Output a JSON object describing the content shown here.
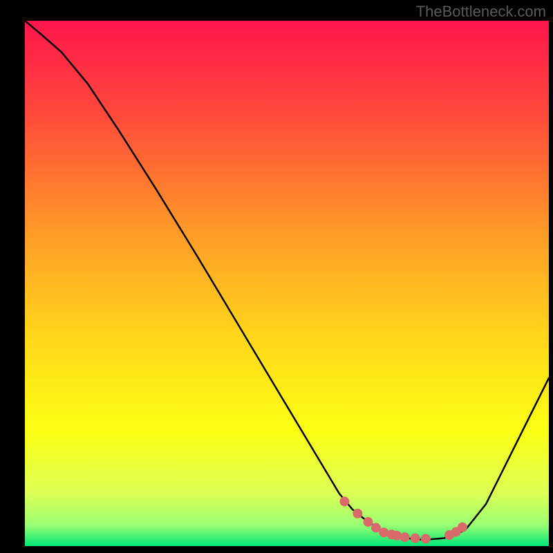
{
  "watermark": "TheBottleneck.com",
  "chart_data": {
    "type": "line",
    "title": "",
    "xlabel": "",
    "ylabel": "",
    "xlim": [
      0,
      100
    ],
    "ylim": [
      0,
      100
    ],
    "gradient_stops": [
      {
        "offset": 0.0,
        "color": "#ff164c"
      },
      {
        "offset": 0.18,
        "color": "#ff4a3a"
      },
      {
        "offset": 0.4,
        "color": "#ff9a28"
      },
      {
        "offset": 0.6,
        "color": "#ffd61a"
      },
      {
        "offset": 0.78,
        "color": "#fbff13"
      },
      {
        "offset": 0.9,
        "color": "#dcff55"
      },
      {
        "offset": 0.96,
        "color": "#9bff73"
      },
      {
        "offset": 1.0,
        "color": "#00e676"
      }
    ],
    "series": [
      {
        "name": "curve",
        "type": "line",
        "color": "#000000",
        "x": [
          0,
          3,
          7,
          12,
          18,
          25,
          33,
          42,
          51,
          57,
          60,
          62.5,
          65,
          68,
          72,
          76,
          80,
          84,
          88,
          92,
          96,
          100
        ],
        "y": [
          100,
          97.5,
          94,
          88,
          79,
          68,
          55,
          40,
          25,
          15,
          10,
          7,
          5,
          3,
          1.6,
          1.2,
          1.5,
          3,
          8,
          16,
          24,
          32
        ]
      },
      {
        "name": "dots",
        "type": "scatter",
        "color": "#d96a6a",
        "radius": 7,
        "x": [
          61,
          63.5,
          65.5,
          67,
          68.5,
          70,
          71,
          72.5,
          74.5,
          76.5,
          81,
          82.3,
          83.5
        ],
        "y": [
          8.5,
          6.2,
          4.6,
          3.5,
          2.6,
          2.2,
          2.0,
          1.7,
          1.5,
          1.4,
          2.1,
          2.7,
          3.6
        ]
      }
    ]
  }
}
